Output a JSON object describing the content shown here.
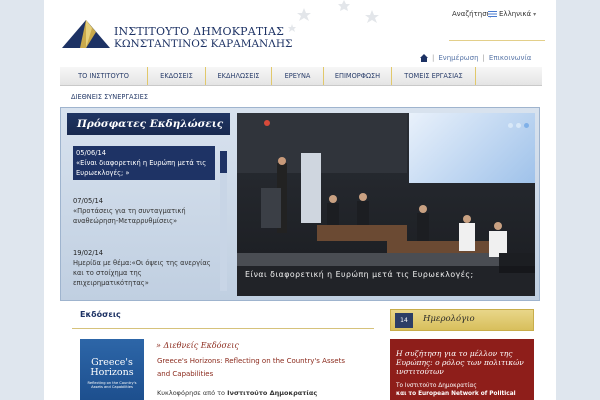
{
  "header": {
    "logo_line1": "ΙΝΣΤΙΤΟΥΤΟ ΔΗΜΟΚΡΑΤΙΑΣ",
    "logo_line2": "ΚΩΝΣΤΑΝΤΙΝΟΣ ΚΑΡΑΜΑΝΛΗΣ",
    "search_label": "Αναζήτηση",
    "language": "Ελληνικά",
    "utility_links": [
      "Ενημέρωση",
      "Επικοινωνία"
    ]
  },
  "nav": {
    "items": [
      "ΤΟ ΙΝΣΤΙΤΟΥΤΟ",
      "ΕΚΔΟΣΕΙΣ",
      "ΕΚΔΗΛΩΣΕΙΣ",
      "ΕΡΕΥΝΑ",
      "ΕΠΙΜΟΡΦΩΣΗ",
      "ΤΟΜΕΙΣ ΕΡΓΑΣΙΑΣ"
    ],
    "second_row": "ΔΙΕΘΝΕΙΣ ΣΥΝΕΡΓΑΣΙΕΣ"
  },
  "events": {
    "title": "Πρόσφατες Εκδηλώσεις",
    "items": [
      {
        "date": "05/06/14",
        "text": "«Είναι διαφορετική η Ευρώπη μετά τις Ευρωεκλογές; »"
      },
      {
        "date": "07/05/14",
        "text": "«Προτάσεις για τη συνταγματική αναθεώρηση-Μεταρρυθμίσεις»"
      },
      {
        "date": "19/02/14",
        "text": "Ημερίδα με θέμα:«Οι όψεις της ανεργίας και τo στοίχημα της επιχειρηματικότητας»"
      }
    ],
    "photo_caption": "Είναι διαφορετική η Ευρώπη μετά τις Ευρωεκλογές;"
  },
  "publications": {
    "heading": "Εκδόσεις",
    "category": "» Διεθνείς Εκδόσεις",
    "book_title": "Greece's Horizons: Reflecting on the Country's Assets and Capabilities",
    "book_cover_title": "Greece's Horizons",
    "book_cover_sub": "Reflecting on the Country's Assets and Capabilities",
    "desc_prefix": "Κυκλοφόρησε από το",
    "desc_bold": "Ινστιτούτο Δημοκρατίας"
  },
  "calendar": {
    "title": "Ημερολόγιο",
    "icon_label": "14",
    "headline": "Η συζήτηση για το μέλλον της Ευρώπης: ο ρόλος των πολιτικών ινστιτούτων",
    "body_line1": "Το Ινστιτούτο Δημοκρατίας",
    "body_line2": "και το European Network of Political"
  },
  "colors": {
    "navy": "#1e3365",
    "gold": "#d8bf5c",
    "calendar_red": "#8e1e1a"
  }
}
